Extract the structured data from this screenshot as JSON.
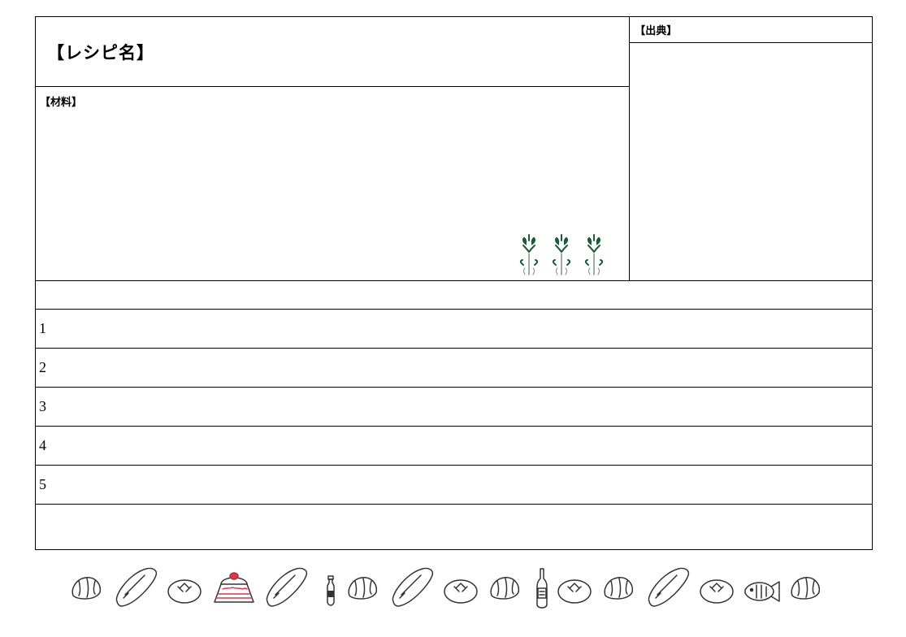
{
  "labels": {
    "recipe_name": "【レシピ名】",
    "ingredients": "【材料】",
    "source": "【出典】"
  },
  "steps": [
    "1",
    "2",
    "3",
    "4",
    "5"
  ],
  "colors": {
    "plant": "#1a5c3a",
    "cake_top": "#d43c4c",
    "cake_lines": "#d43c4c",
    "outline": "#222"
  }
}
